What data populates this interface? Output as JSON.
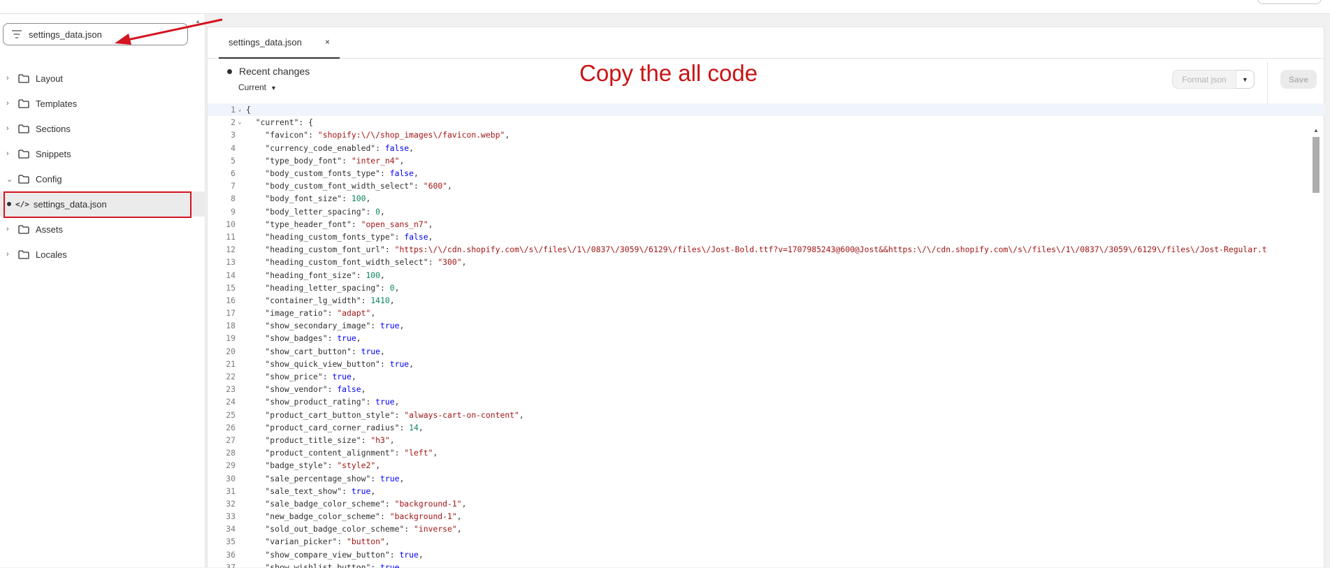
{
  "sidebar": {
    "search_value": "settings_data.json",
    "folders": [
      {
        "label": "Layout"
      },
      {
        "label": "Templates"
      },
      {
        "label": "Sections"
      },
      {
        "label": "Snippets"
      },
      {
        "label": "Config"
      }
    ],
    "open_file": "settings_data.json",
    "folders_after": [
      {
        "label": "Assets"
      },
      {
        "label": "Locales"
      }
    ]
  },
  "editor": {
    "tab_label": "settings_data.json",
    "tab_close": "×",
    "recent_changes": "Recent changes",
    "version_label": "Current",
    "format_label": "Format json",
    "save_label": "Save",
    "annotation": "Copy the all code"
  },
  "colors": {
    "annotation_red": "#c81414",
    "string": "#a31515",
    "number": "#098658",
    "keyword": "#0000ff"
  },
  "code_lines": [
    {
      "n": "1",
      "fold": "⌄",
      "key": "",
      "indent": "",
      "val": "",
      "type": "open"
    },
    {
      "n": "2",
      "fold": "⌄",
      "key": "current",
      "indent": "  ",
      "val": "{",
      "type": "obj"
    },
    {
      "n": "3",
      "fold": "",
      "key": "favicon",
      "indent": "    ",
      "val": "\"shopify:\\/\\/shop_images\\/favicon.webp\"",
      "type": "str"
    },
    {
      "n": "4",
      "fold": "",
      "key": "currency_code_enabled",
      "indent": "    ",
      "val": "false",
      "type": "kw"
    },
    {
      "n": "5",
      "fold": "",
      "key": "type_body_font",
      "indent": "    ",
      "val": "\"inter_n4\"",
      "type": "str"
    },
    {
      "n": "6",
      "fold": "",
      "key": "body_custom_fonts_type",
      "indent": "    ",
      "val": "false",
      "type": "kw"
    },
    {
      "n": "7",
      "fold": "",
      "key": "body_custom_font_width_select",
      "indent": "    ",
      "val": "\"600\"",
      "type": "str"
    },
    {
      "n": "8",
      "fold": "",
      "key": "body_font_size",
      "indent": "    ",
      "val": "100",
      "type": "num"
    },
    {
      "n": "9",
      "fold": "",
      "key": "body_letter_spacing",
      "indent": "    ",
      "val": "0",
      "type": "num"
    },
    {
      "n": "10",
      "fold": "",
      "key": "type_header_font",
      "indent": "    ",
      "val": "\"open_sans_n7\"",
      "type": "str"
    },
    {
      "n": "11",
      "fold": "",
      "key": "heading_custom_fonts_type",
      "indent": "    ",
      "val": "false",
      "type": "kw"
    },
    {
      "n": "12",
      "fold": "",
      "key": "heading_custom_font_url",
      "indent": "    ",
      "val": "\"https:\\/\\/cdn.shopify.com\\/s\\/files\\/1\\/0837\\/3059\\/6129\\/files\\/Jost-Bold.ttf?v=1707985243@600@Jost&&https:\\/\\/cdn.shopify.com\\/s\\/files\\/1\\/0837\\/3059\\/6129\\/files\\/Jost-Regular.t",
      "type": "str_open"
    },
    {
      "n": "13",
      "fold": "",
      "key": "heading_custom_font_width_select",
      "indent": "    ",
      "val": "\"300\"",
      "type": "str"
    },
    {
      "n": "14",
      "fold": "",
      "key": "heading_font_size",
      "indent": "    ",
      "val": "100",
      "type": "num"
    },
    {
      "n": "15",
      "fold": "",
      "key": "heading_letter_spacing",
      "indent": "    ",
      "val": "0",
      "type": "num"
    },
    {
      "n": "16",
      "fold": "",
      "key": "container_lg_width",
      "indent": "    ",
      "val": "1410",
      "type": "num"
    },
    {
      "n": "17",
      "fold": "",
      "key": "image_ratio",
      "indent": "    ",
      "val": "\"adapt\"",
      "type": "str"
    },
    {
      "n": "18",
      "fold": "",
      "key": "show_secondary_image",
      "indent": "    ",
      "val": "true",
      "type": "kw"
    },
    {
      "n": "19",
      "fold": "",
      "key": "show_badges",
      "indent": "    ",
      "val": "true",
      "type": "kw"
    },
    {
      "n": "20",
      "fold": "",
      "key": "show_cart_button",
      "indent": "    ",
      "val": "true",
      "type": "kw"
    },
    {
      "n": "21",
      "fold": "",
      "key": "show_quick_view_button",
      "indent": "    ",
      "val": "true",
      "type": "kw"
    },
    {
      "n": "22",
      "fold": "",
      "key": "show_price",
      "indent": "    ",
      "val": "true",
      "type": "kw"
    },
    {
      "n": "23",
      "fold": "",
      "key": "show_vendor",
      "indent": "    ",
      "val": "false",
      "type": "kw"
    },
    {
      "n": "24",
      "fold": "",
      "key": "show_product_rating",
      "indent": "    ",
      "val": "true",
      "type": "kw"
    },
    {
      "n": "25",
      "fold": "",
      "key": "product_cart_button_style",
      "indent": "    ",
      "val": "\"always-cart-on-content\"",
      "type": "str"
    },
    {
      "n": "26",
      "fold": "",
      "key": "product_card_corner_radius",
      "indent": "    ",
      "val": "14",
      "type": "num"
    },
    {
      "n": "27",
      "fold": "",
      "key": "product_title_size",
      "indent": "    ",
      "val": "\"h3\"",
      "type": "str"
    },
    {
      "n": "28",
      "fold": "",
      "key": "product_content_alignment",
      "indent": "    ",
      "val": "\"left\"",
      "type": "str"
    },
    {
      "n": "29",
      "fold": "",
      "key": "badge_style",
      "indent": "    ",
      "val": "\"style2\"",
      "type": "str"
    },
    {
      "n": "30",
      "fold": "",
      "key": "sale_percentage_show",
      "indent": "    ",
      "val": "true",
      "type": "kw"
    },
    {
      "n": "31",
      "fold": "",
      "key": "sale_text_show",
      "indent": "    ",
      "val": "true",
      "type": "kw"
    },
    {
      "n": "32",
      "fold": "",
      "key": "sale_badge_color_scheme",
      "indent": "    ",
      "val": "\"background-1\"",
      "type": "str"
    },
    {
      "n": "33",
      "fold": "",
      "key": "new_badge_color_scheme",
      "indent": "    ",
      "val": "\"background-1\"",
      "type": "str"
    },
    {
      "n": "34",
      "fold": "",
      "key": "sold_out_badge_color_scheme",
      "indent": "    ",
      "val": "\"inverse\"",
      "type": "str"
    },
    {
      "n": "35",
      "fold": "",
      "key": "varian_picker",
      "indent": "    ",
      "val": "\"button\"",
      "type": "str"
    },
    {
      "n": "36",
      "fold": "",
      "key": "show_compare_view_button",
      "indent": "    ",
      "val": "true",
      "type": "kw"
    },
    {
      "n": "37",
      "fold": "",
      "key": "show_wishlist_button",
      "indent": "    ",
      "val": "true",
      "type": "kw"
    }
  ]
}
